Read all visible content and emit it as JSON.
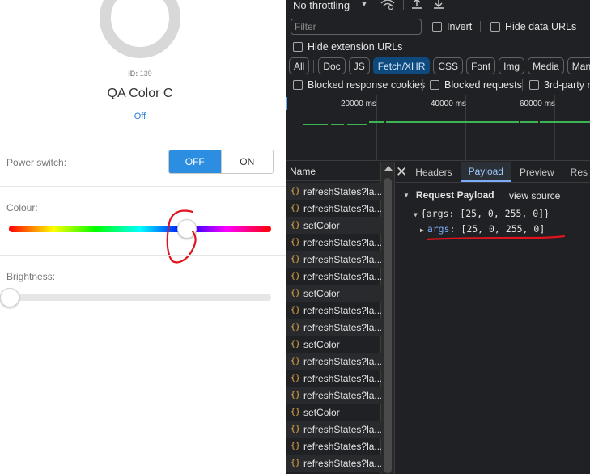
{
  "device": {
    "id_label": "ID:",
    "id_value": "139",
    "name": "QA Color C",
    "state": "Off"
  },
  "controls": {
    "power_label": "Power switch:",
    "off_label": "OFF",
    "on_label": "ON",
    "power_state": "OFF",
    "colour_label": "Colour:",
    "colour_value_fraction": 0.68,
    "brightness_label": "Brightness:",
    "brightness_value_fraction": 0.0
  },
  "colors": {
    "accent_blue": "#2b8ee0",
    "annotation_red": "#e0141e",
    "devtools_bg": "#202124",
    "active_chip": "#0e4a7e",
    "timeline_bar": "#3cb454",
    "key_blue": "#7cacf8",
    "xhr_icon": "#f0b44a"
  },
  "devtools": {
    "throttling": "No throttling",
    "filter_placeholder": "Filter",
    "invert_label": "Invert",
    "hide_data_urls_label": "Hide data URLs",
    "hide_extension_urls_label": "Hide extension URLs",
    "chips": [
      {
        "label": "All",
        "active": false
      },
      {
        "label": "Doc",
        "active": false
      },
      {
        "label": "JS",
        "active": false
      },
      {
        "label": "Fetch/XHR",
        "active": true
      },
      {
        "label": "CSS",
        "active": false
      },
      {
        "label": "Font",
        "active": false
      },
      {
        "label": "Img",
        "active": false
      },
      {
        "label": "Media",
        "active": false
      },
      {
        "label": "Manifest",
        "active": false
      }
    ],
    "blocked_cookies_label": "Blocked response cookies",
    "blocked_requests_label": "Blocked requests",
    "third_party_label": "3rd-party r",
    "timeline_ticks": [
      "20000 ms",
      "40000 ms",
      "60000 ms"
    ],
    "name_header": "Name",
    "requests": [
      "refreshStates?la...",
      "refreshStates?la...",
      "setColor",
      "refreshStates?la...",
      "refreshStates?la...",
      "refreshStates?la...",
      "setColor",
      "refreshStates?la...",
      "refreshStates?la...",
      "setColor",
      "refreshStates?la...",
      "refreshStates?la...",
      "refreshStates?la...",
      "setColor",
      "refreshStates?la...",
      "refreshStates?la...",
      "refreshStates?la..."
    ],
    "tabs": [
      {
        "label": "Headers",
        "active": false
      },
      {
        "label": "Payload",
        "active": true
      },
      {
        "label": "Preview",
        "active": false
      },
      {
        "label": "Res",
        "active": false
      }
    ],
    "payload_title": "Request Payload",
    "view_source": "view source",
    "payload_object": "{args: [25, 0, 255, 0]}",
    "args_key": "args",
    "args_value": "[25, 0, 255, 0]"
  }
}
